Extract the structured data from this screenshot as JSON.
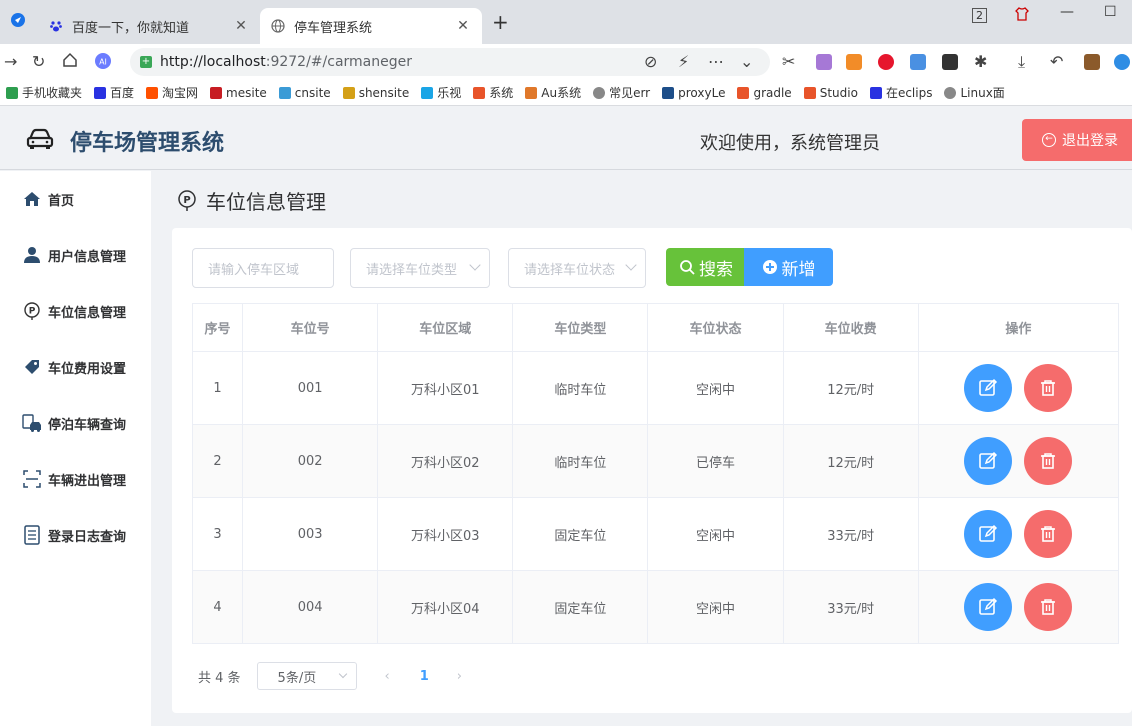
{
  "browser": {
    "tabs": [
      {
        "label": "百度一下，你就知道",
        "icon": "baidu-paw-icon"
      },
      {
        "label": "停车管理系统",
        "icon": "globe-icon"
      }
    ],
    "url_host": "http://localhost",
    "url_rest": ":9272/#/carmaneger",
    "window_badge": "2",
    "bookmarks": [
      {
        "label": "手机收藏夹",
        "color": "#2e9e4f"
      },
      {
        "label": "百度",
        "color": "#2932e1"
      },
      {
        "label": "淘宝网",
        "color": "#ff5000"
      },
      {
        "label": "mesite",
        "color": "#c71d23"
      },
      {
        "label": "cnsite",
        "color": "#3b9bd6"
      },
      {
        "label": "shensite",
        "color": "#d4a017"
      },
      {
        "label": "乐视",
        "color": "#1aa5e6"
      },
      {
        "label": "系统",
        "color": "#e8542a"
      },
      {
        "label": "Au系统",
        "color": "#e0782a"
      },
      {
        "label": "常见err",
        "color": "#888888"
      },
      {
        "label": "proxyLe",
        "color": "#1d4e89"
      },
      {
        "label": "gradle",
        "color": "#e8542a"
      },
      {
        "label": "Studio",
        "color": "#e8542a"
      },
      {
        "label": "在eclips",
        "color": "#2932e1"
      },
      {
        "label": "Linux面",
        "color": "#888888"
      }
    ]
  },
  "header": {
    "title": "停车场管理系统",
    "welcome": "欢迎使用，系统管理员",
    "logout_label": "退出登录"
  },
  "sidebar": {
    "items": [
      {
        "label": "首页",
        "icon": "home-icon"
      },
      {
        "label": "用户信息管理",
        "icon": "user-icon"
      },
      {
        "label": "车位信息管理",
        "icon": "parking-icon"
      },
      {
        "label": "车位费用设置",
        "icon": "price-tag-icon"
      },
      {
        "label": "停泊车辆查询",
        "icon": "car-search-icon"
      },
      {
        "label": "车辆进出管理",
        "icon": "scan-icon"
      },
      {
        "label": "登录日志查询",
        "icon": "log-icon"
      }
    ]
  },
  "main": {
    "page_title": "车位信息管理",
    "filters": {
      "area_placeholder": "请输入停车区域",
      "type_placeholder": "请选择车位类型",
      "status_placeholder": "请选择车位状态"
    },
    "search_label": "搜索",
    "add_label": "新增",
    "table": {
      "headers": [
        "序号",
        "车位号",
        "车位区域",
        "车位类型",
        "车位状态",
        "车位收费",
        "操作"
      ],
      "rows": [
        [
          "1",
          "001",
          "万科小区01",
          "临时车位",
          "空闲中",
          "12元/时"
        ],
        [
          "2",
          "002",
          "万科小区02",
          "临时车位",
          "已停车",
          "12元/时"
        ],
        [
          "3",
          "003",
          "万科小区03",
          "固定车位",
          "空闲中",
          "33元/时"
        ],
        [
          "4",
          "004",
          "万科小区04",
          "固定车位",
          "空闲中",
          "33元/时"
        ]
      ]
    },
    "pagination": {
      "total": "共 4 条",
      "page_size": "5条/页",
      "current": "1"
    }
  },
  "colors": {
    "primary": "#409eff",
    "success": "#67c23a",
    "danger": "#f56c6c",
    "title": "#2d4d6e"
  }
}
